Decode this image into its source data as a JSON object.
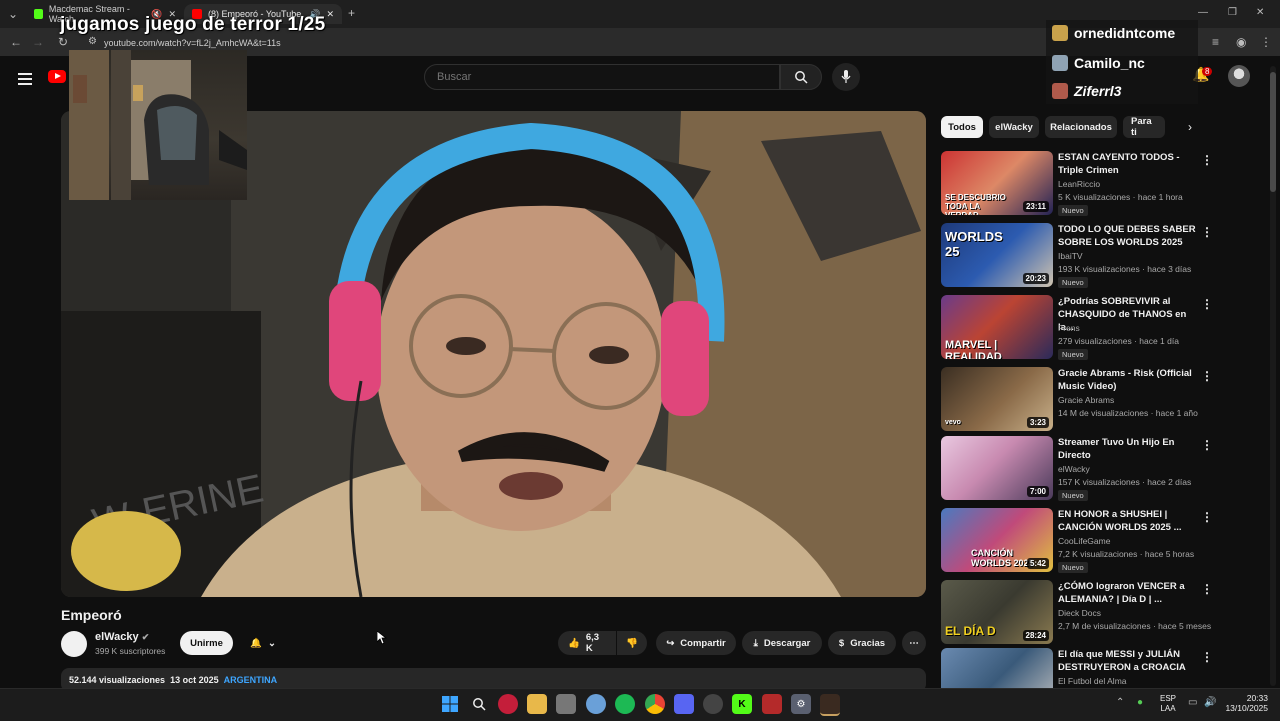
{
  "browser": {
    "tabs": [
      {
        "label": "Macdemac Stream - Watch",
        "active": false
      },
      {
        "label": "(8) Empeoró - YouTube",
        "active": true
      }
    ],
    "new_tab": "+",
    "url": "youtube.com/watch?v=fL2j_AmhcWA&t=11s"
  },
  "stream_overlay": {
    "title": "jugamos juego de terror  1/25",
    "chat": [
      "ornedidntcome",
      "Camilo_nc",
      "Ziferrl3"
    ]
  },
  "header": {
    "search_placeholder": "Buscar",
    "notifications": "8"
  },
  "video": {
    "title": "Empeoró",
    "channel": "elWacky",
    "subscribers": "399 K suscriptores",
    "join_label": "Unirme",
    "likes": "6,3 K",
    "share_label": "Compartir",
    "download_label": "Descargar",
    "thanks_label": "Gracias",
    "views": "52.144 visualizaciones",
    "date": "13 oct 2025",
    "tag": "ARGENTINA"
  },
  "chips": [
    "Todos",
    "elWacky",
    "Relacionados",
    "Para ti"
  ],
  "recommendations": [
    {
      "title": "ESTAN CAYENTO TODOS - Triple Crimen",
      "channel": "LeanRiccio",
      "meta": "5 K visualizaciones · hace 1 hora",
      "badge": "Nuevo",
      "duration": "23:11",
      "thumb_text": "SE DESCUBRIO TODA LA VERDAD"
    },
    {
      "title": "TODO LO QUE DEBES SABER SOBRE LOS WORLDS 2025",
      "channel": "IbaiTV",
      "meta": "193 K visualizaciones · hace 3 días",
      "badge": "Nuevo",
      "duration": "20:23",
      "thumb_text": "WORLDS 25"
    },
    {
      "title": "¿Podrías SOBREVIVIR al CHASQUIDO de THANOS en la...",
      "channel": "Frens",
      "meta": "279 visualizaciones · hace 1 día",
      "badge": "Nuevo",
      "duration": "",
      "thumb_text": "MARVEL | REALIDAD"
    },
    {
      "title": "Gracie Abrams - Risk (Official Music Video)",
      "channel": "Gracie Abrams",
      "meta": "14 M de visualizaciones · hace 1 año",
      "badge": "",
      "duration": "3:23",
      "thumb_text": "vevo"
    },
    {
      "title": "Streamer Tuvo Un Hijo En Directo",
      "channel": "elWacky",
      "meta": "157 K visualizaciones · hace 2 días",
      "badge": "Nuevo",
      "duration": "7:00",
      "thumb_text": ""
    },
    {
      "title": "EN HONOR a SHUSHEI | CANCIÓN WORLDS 2025 ...",
      "channel": "CooLifeGame",
      "meta": "7,2 K visualizaciones · hace 5 horas",
      "badge": "Nuevo",
      "duration": "5:42",
      "thumb_text": "CANCIÓN WORLDS 2025"
    },
    {
      "title": "¿CÓMO lograron VENCER a ALEMANIA? | Día D | ...",
      "channel": "Dieck Docs",
      "meta": "2,7 M de visualizaciones · hace 5 meses",
      "badge": "",
      "duration": "28:24",
      "thumb_text": "EL DÍA D"
    },
    {
      "title": "El día que MESSI y JULIÁN DESTRUYERON a CROACIA",
      "channel": "El Futbol del Alma",
      "meta": "",
      "badge": "",
      "duration": "",
      "thumb_text": ""
    }
  ],
  "taskbar": {
    "lang_line1": "ESP",
    "lang_line2": "LAA",
    "time": "20:33",
    "date": "13/10/2025"
  },
  "colors": {
    "background": "#0f0f0f",
    "youtube_red": "#ff0000",
    "link_blue": "#3ea6ff"
  }
}
